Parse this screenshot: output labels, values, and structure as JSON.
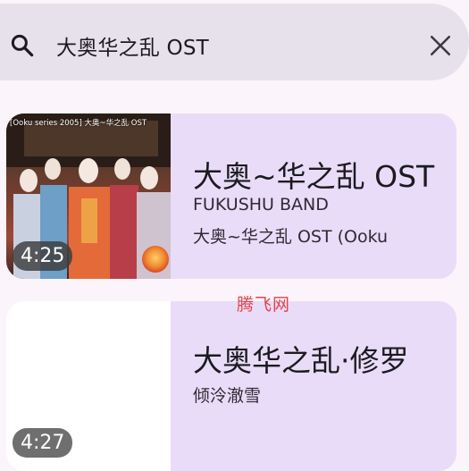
{
  "search": {
    "query": "大奥华之乱 OST",
    "icon": "search-icon",
    "clear_icon": "close-icon"
  },
  "results": [
    {
      "title": "大奥~华之乱 OST",
      "artist": "FUKUSHU BAND",
      "album": "大奥~华之乱 OST (Ooku",
      "duration": "4:25",
      "thumbnail_caption": "[Ooku series 2005] 大奥~华之乱 OST"
    },
    {
      "title": "大奥华之乱·修罗",
      "artist": "倾泠澈雪",
      "duration": "4:27"
    }
  ],
  "watermark": "腾飞网",
  "colors": {
    "background": "#fbf4fb",
    "search_bar": "#e7e1eb",
    "card": "#e9dcf9",
    "watermark": "#e5424a"
  }
}
